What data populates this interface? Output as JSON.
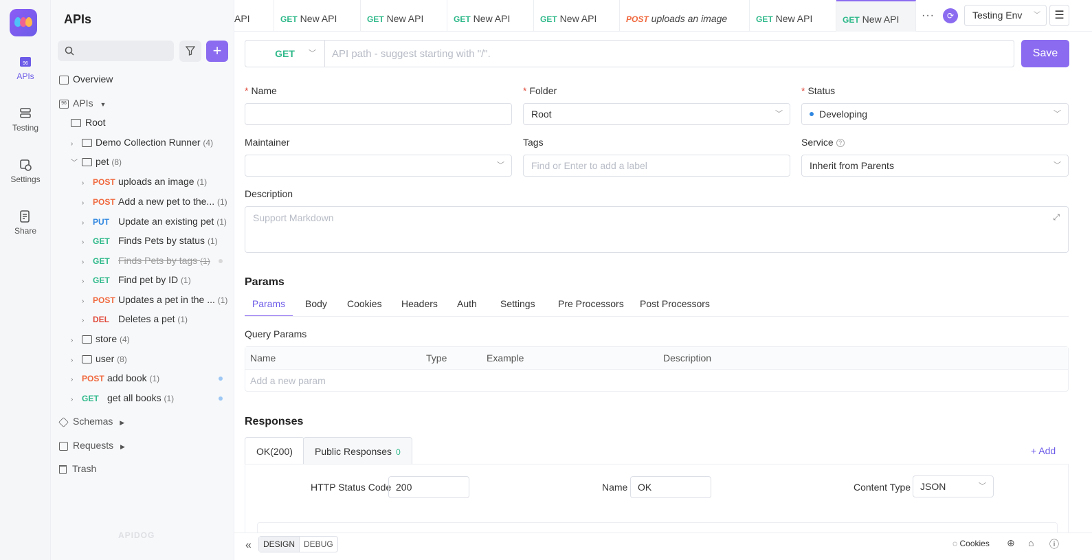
{
  "rail": {
    "items": [
      {
        "label": "APIs",
        "icon": "apis-icon",
        "active": true
      },
      {
        "label": "Testing",
        "icon": "testing-icon"
      },
      {
        "label": "Settings",
        "icon": "settings-icon"
      },
      {
        "label": "Share",
        "icon": "share-icon"
      }
    ]
  },
  "sidebar": {
    "title": "APIs",
    "search_placeholder": "",
    "overview": "Overview",
    "apis": "APIs",
    "root": "Root",
    "tree": [
      {
        "type": "folder",
        "label": "Demo Collection Runner",
        "count": "(4)"
      },
      {
        "type": "folder",
        "label": "pet",
        "count": "(8)"
      },
      {
        "type": "api",
        "method": "POST",
        "label": "uploads an image",
        "count": "(1)"
      },
      {
        "type": "api",
        "method": "POST",
        "label": "Add a new pet to the...",
        "count": "(1)"
      },
      {
        "type": "api",
        "method": "PUT",
        "label": "Update an existing pet",
        "count": "(1)"
      },
      {
        "type": "api",
        "method": "GET",
        "label": "Finds Pets by status",
        "count": "(1)"
      },
      {
        "type": "api",
        "method": "GET",
        "label": "Finds Pets by tags",
        "count": "(1)"
      },
      {
        "type": "api",
        "method": "GET",
        "label": "Find pet by ID",
        "count": "(1)"
      },
      {
        "type": "api",
        "method": "POST",
        "label": "Updates a pet in the ...",
        "count": "(1)"
      },
      {
        "type": "api",
        "method": "DEL",
        "label": "Deletes a pet",
        "count": "(1)"
      },
      {
        "type": "folder",
        "label": "store",
        "count": "(4)"
      },
      {
        "type": "folder",
        "label": "user",
        "count": "(8)"
      },
      {
        "type": "api",
        "method": "POST",
        "label": "add book",
        "count": "(1)"
      },
      {
        "type": "api",
        "method": "GET",
        "label": "get all books",
        "count": "(1)"
      }
    ],
    "schemas": "Schemas",
    "requests": "Requests",
    "trash": "Trash",
    "watermark": "APIDOG"
  },
  "tabs": [
    {
      "method": "",
      "label": "API"
    },
    {
      "method": "GET",
      "label": "New API"
    },
    {
      "method": "GET",
      "label": "New API"
    },
    {
      "method": "GET",
      "label": "New API"
    },
    {
      "method": "GET",
      "label": "New API"
    },
    {
      "method": "POST",
      "label": "uploads an image"
    },
    {
      "method": "GET",
      "label": "New API"
    },
    {
      "method": "GET",
      "label": "New API"
    }
  ],
  "header": {
    "more": "···",
    "env": "Testing Env"
  },
  "url": {
    "method": "GET",
    "placeholder": "API path - suggest starting with \"/\".",
    "save": "Save"
  },
  "form": {
    "name_label": "Name",
    "folder_label": "Folder",
    "folder_value": "Root",
    "status_label": "Status",
    "status_value": "Developing",
    "maintainer_label": "Maintainer",
    "tags_label": "Tags",
    "tags_placeholder": "Find or Enter to add a label",
    "service_label": "Service",
    "service_value": "Inherit from Parents",
    "description_label": "Description",
    "description_placeholder": "Support Markdown"
  },
  "params": {
    "title": "Params",
    "tabs": [
      "Params",
      "Body",
      "Cookies",
      "Headers",
      "Auth",
      "Settings",
      "Pre Processors",
      "Post Processors"
    ],
    "query_title": "Query Params",
    "columns": [
      "Name",
      "Type",
      "Example",
      "Description"
    ],
    "add_placeholder": "Add a new param"
  },
  "responses": {
    "title": "Responses",
    "tab_ok": "OK(200)",
    "tab_public": "Public Responses",
    "public_count": "0",
    "add": "+ Add",
    "status_code_label": "HTTP Status Code",
    "status_code_value": "200",
    "name_label": "Name",
    "name_value": "OK",
    "content_type_label": "Content Type",
    "content_type_value": "JSON"
  },
  "footer": {
    "design": "DESIGN",
    "debug": "DEBUG",
    "cookies": "Cookies"
  }
}
